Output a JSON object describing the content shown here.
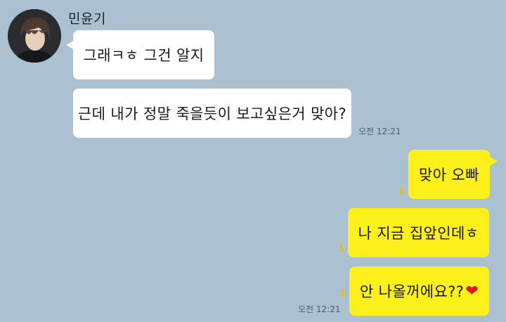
{
  "sender": {
    "name": "민윤기",
    "avatar_icon": "profile-photo"
  },
  "messages": [
    {
      "side": "in",
      "text": "그래ㅋㅎ 그건 알지"
    },
    {
      "side": "in",
      "text": "근데 내가 정말 죽을듯이 보고싶은거 맞아?",
      "time": "오전 12:21"
    },
    {
      "side": "out",
      "text": "맞아 오빠",
      "unread": "1"
    },
    {
      "side": "out",
      "text": "나 지금 집앞인데ㅎ",
      "unread": "1"
    },
    {
      "side": "out",
      "text": "안 나올꺼에요??",
      "emoji": "❤",
      "unread": "1",
      "time": "오전 12:21"
    }
  ],
  "colors": {
    "background": "#abc1d1",
    "incoming_bubble": "#ffffff",
    "outgoing_bubble": "#fef01b",
    "unread_count": "#e0c000",
    "heart": "#e0161e"
  }
}
